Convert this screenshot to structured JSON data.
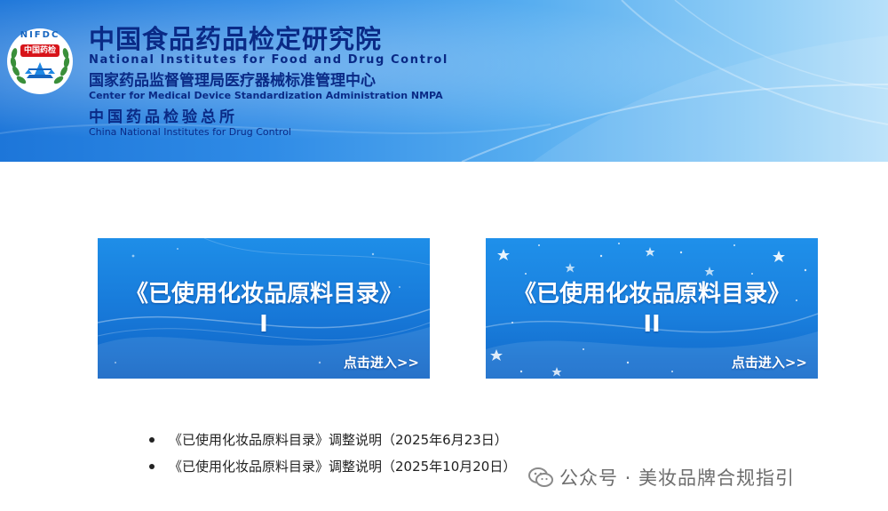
{
  "header": {
    "logo": {
      "text_top": "NIFDC",
      "text_center": "中国药检"
    },
    "org_cn_main": "中国食品药品检定研究院",
    "org_en_main": "National Institutes for Food and Drug Control",
    "org_cn_2": "国家药品监督管理局医疗器械标准管理中心",
    "org_en_2": "Center for Medical Device Standardization Administration NMPA",
    "org_cn_3": "中国药品检验总所",
    "org_en_3": "China National Institutes for Drug Control"
  },
  "cards": [
    {
      "title": "《已使用化妆品原料目录》",
      "numeral": "I",
      "enter": "点击进入>>"
    },
    {
      "title": "《已使用化妆品原料目录》",
      "numeral": "II",
      "enter": "点击进入>>"
    }
  ],
  "notes": [
    {
      "text": "《已使用化妆品原料目录》调整说明（2025年6月23日）"
    },
    {
      "text": "《已使用化妆品原料目录》调整说明（2025年10月20日）"
    }
  ],
  "watermark": {
    "text": "公众号 · 美妆品牌合规指引"
  },
  "colors": {
    "header_navy": "#0a2a86",
    "card_blue": "#1778d8",
    "logo_red": "#d7141a",
    "logo_green": "#3a8f3a"
  }
}
